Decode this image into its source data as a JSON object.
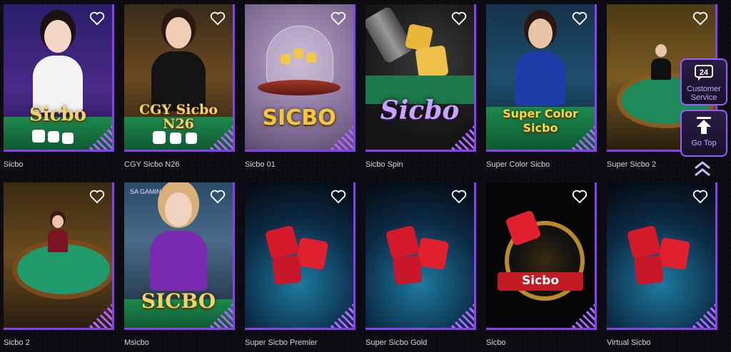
{
  "games": [
    {
      "title": "Sicbo",
      "banner": "Sicbo",
      "theme": "live-purple"
    },
    {
      "title": "CGY Sicbo N26",
      "banner": "CGY Sicbo N26",
      "theme": "live-gold"
    },
    {
      "title": "Sicbo 01",
      "banner": "SICBO",
      "theme": "dome"
    },
    {
      "title": "Sicbo Spin",
      "banner": "Sicbo",
      "theme": "spin"
    },
    {
      "title": "Super Color Sicbo",
      "banner": "Super Color Sicbo",
      "theme": "live-blue"
    },
    {
      "title": "Super Sicbo 2",
      "banner": "",
      "theme": "table-gold"
    },
    {
      "title": "Sicbo 2",
      "banner": "",
      "theme": "table-gold2"
    },
    {
      "title": "Msicbo",
      "banner": "SICBO",
      "brand": "SA GAMING",
      "theme": "live-blonde"
    },
    {
      "title": "Super Sicbo Premier",
      "banner": "",
      "theme": "red-dice"
    },
    {
      "title": "Super Sicbo Gold",
      "banner": "",
      "theme": "red-dice"
    },
    {
      "title": "Sicbo",
      "banner": "Sicbo",
      "theme": "wheel"
    },
    {
      "title": "Virtual Sicbo",
      "banner": "",
      "theme": "red-dice"
    }
  ],
  "side": {
    "customer_service_label": "Customer Service",
    "customer_service_badge": "24",
    "go_top_label": "Go Top"
  },
  "colors": {
    "accent": "#8a3ff0",
    "background": "#0d0b12",
    "caption": "#d8d3e3"
  },
  "icons": {
    "favorite": "heart-outline-icon",
    "service": "24h-support-icon",
    "top": "arrow-up-icon",
    "scroll": "double-chevron-up-icon"
  }
}
